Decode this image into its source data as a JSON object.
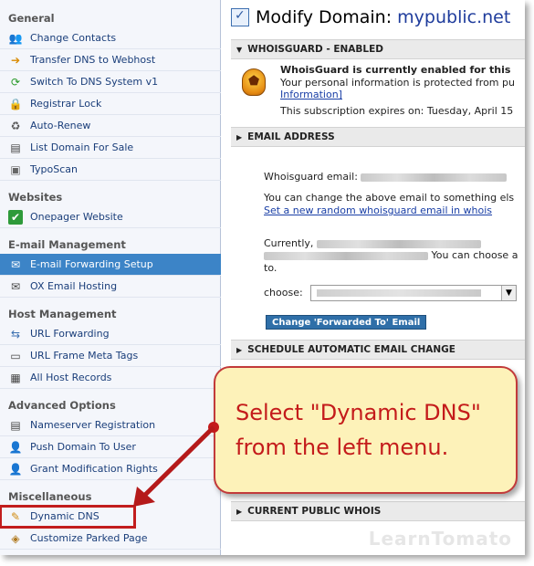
{
  "sidebar": {
    "sections": [
      {
        "title": "General",
        "items": [
          {
            "label": "Change Contacts",
            "icon": "contacts-icon"
          },
          {
            "label": "Transfer DNS to Webhost",
            "icon": "arrow-right-icon"
          },
          {
            "label": "Switch To DNS System v1",
            "icon": "switch-icon"
          },
          {
            "label": "Registrar Lock",
            "icon": "lock-icon"
          },
          {
            "label": "Auto-Renew",
            "icon": "renew-icon"
          },
          {
            "label": "List Domain For Sale",
            "icon": "sale-icon"
          },
          {
            "label": "TypoScan",
            "icon": "typoscan-icon"
          }
        ]
      },
      {
        "title": "Websites",
        "items": [
          {
            "label": "Onepager Website",
            "icon": "check-icon"
          }
        ]
      },
      {
        "title": "E-mail Management",
        "items": [
          {
            "label": "E-mail Forwarding Setup",
            "icon": "mail-forward-icon"
          },
          {
            "label": "OX Email Hosting",
            "icon": "mail-icon"
          }
        ]
      },
      {
        "title": "Host Management",
        "items": [
          {
            "label": "URL Forwarding",
            "icon": "url-forward-icon"
          },
          {
            "label": "URL Frame Meta Tags",
            "icon": "frame-icon"
          },
          {
            "label": "All Host Records",
            "icon": "host-records-icon"
          }
        ]
      },
      {
        "title": "Advanced Options",
        "items": [
          {
            "label": "Nameserver Registration",
            "icon": "nameserver-icon"
          },
          {
            "label": "Push Domain To User",
            "icon": "push-user-icon"
          },
          {
            "label": "Grant Modification Rights",
            "icon": "grant-icon"
          }
        ]
      },
      {
        "title": "Miscellaneous",
        "items": [
          {
            "label": "Dynamic DNS",
            "icon": "dynamic-dns-icon"
          },
          {
            "label": "Customize Parked Page",
            "icon": "parked-page-icon"
          }
        ]
      }
    ],
    "active_item": "E-mail Forwarding Setup",
    "highlighted_item": "Dynamic DNS"
  },
  "main": {
    "title_prefix": "Modify Domain:",
    "domain": "mypublic.net",
    "whoisguard_bar": "WHOISGUARD - ENABLED",
    "whoisguard_heading": "WhoisGuard is currently enabled for this",
    "whoisguard_line2": "Your personal information is protected from pu",
    "whoisguard_link": "Information]",
    "whoisguard_expires": "This subscription expires on: Tuesday, April 15",
    "email_bar": "EMAIL ADDRESS",
    "whoisguard_email_label": "Whoisguard email:",
    "change_email_text": "You can change the above email to something els",
    "random_email_link": "Set a new random whoisguard email in whois",
    "currently_label": "Currently,",
    "choose_text": "You can choose a",
    "to_text": "to.",
    "choose_label": "choose:",
    "change_button": "Change 'Forwarded To' Email",
    "schedule_bar": "SCHEDULE AUTOMATIC EMAIL CHANGE",
    "public_whois_bar": "CURRENT PUBLIC WHOIS"
  },
  "callout": {
    "text": "Select \"Dynamic DNS\"\nfrom the left menu."
  },
  "watermark": "LearnTomato",
  "colors": {
    "active_item_bg": "#3c84c7",
    "link": "#1a3fa6",
    "callout_bg": "#fdf2b9",
    "callout_border": "#c23a3a",
    "callout_text": "#c41b1b",
    "highlight_box": "#c21d1d"
  }
}
